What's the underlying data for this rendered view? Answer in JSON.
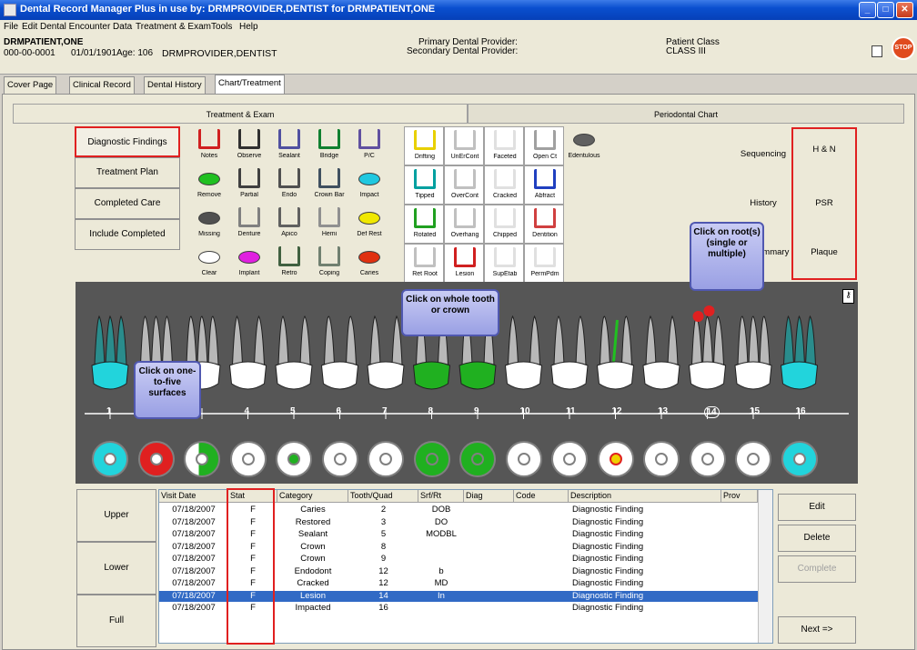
{
  "window": {
    "title": "Dental Record Manager Plus in use by: DRMPROVIDER,DENTIST for DRMPATIENT,ONE"
  },
  "menu": [
    "File",
    "Edit",
    "Dental Encounter Data",
    "Treatment & Exam",
    "Tools",
    "Help"
  ],
  "patient": {
    "name": "DRMPATIENT,ONE",
    "id_line": "000-00-0001",
    "dob": "01/01/1901",
    "age": "Age: 106",
    "provider": "DRMPROVIDER,DENTIST",
    "primary_label": "Primary Dental Provider:",
    "secondary_label": "Secondary Dental Provider:",
    "class_label": "Patient Class",
    "class_value": "CLASS III"
  },
  "tabs": [
    "Cover Page",
    "Clinical Record",
    "Dental History",
    "Chart/Treatment"
  ],
  "subtabs": [
    "Treatment & Exam",
    "Periodontal Chart"
  ],
  "left_buttons": [
    "Diagnostic Findings",
    "Treatment Plan",
    "Completed Care",
    "Include Completed"
  ],
  "tools": [
    [
      "Notes",
      "Observe",
      "Sealant",
      "Bridge",
      "P/C",
      "Drifting",
      "UnErCont",
      "Faceted",
      "Open Ct",
      "Edentulous"
    ],
    [
      "Remove",
      "Partial",
      "Endo",
      "Crown Bar",
      "Impact",
      "Tipped",
      "OverCont",
      "Cracked",
      "Abfract",
      ""
    ],
    [
      "Missing",
      "Denture",
      "Apico",
      "Hemi",
      "Def Rest",
      "Rotated",
      "Overhang",
      "Chipped",
      "Dentition",
      ""
    ],
    [
      "Clear",
      "Implant",
      "Retro",
      "Coping",
      "Caries",
      "Ret Root",
      "Lesion",
      "SupEtab",
      "PermPdm",
      ""
    ]
  ],
  "side_buttons": [
    "Sequencing",
    "History",
    "Summary"
  ],
  "red_buttons": [
    "H & N",
    "PSR",
    "Plaque"
  ],
  "callouts": {
    "whole": "Click on whole tooth or crown",
    "root": "Click on root(s) (single or multiple)",
    "surface": "Click on one-to-five surfaces"
  },
  "tooth_numbers": [
    "1",
    "4",
    "5",
    "6",
    "7",
    "8",
    "9",
    "10",
    "11",
    "12",
    "13",
    "14",
    "15",
    "16"
  ],
  "arch_tabs": [
    "Upper",
    "Lower",
    "Full"
  ],
  "grid": {
    "headers": [
      "Visit Date",
      "Stat",
      "Category",
      "Tooth/Quad",
      "Srf/Rt",
      "Diag",
      "Code",
      "Description",
      "Prov"
    ],
    "rows": [
      [
        "07/18/2007",
        "F",
        "Caries",
        "2",
        "DOB",
        "",
        "",
        "Diagnostic Finding",
        ""
      ],
      [
        "07/18/2007",
        "F",
        "Restored",
        "3",
        "DO",
        "",
        "",
        "Diagnostic Finding",
        ""
      ],
      [
        "07/18/2007",
        "F",
        "Sealant",
        "5",
        "MODBL",
        "",
        "",
        "Diagnostic Finding",
        ""
      ],
      [
        "07/18/2007",
        "F",
        "Crown",
        "8",
        "",
        "",
        "",
        "Diagnostic Finding",
        ""
      ],
      [
        "07/18/2007",
        "F",
        "Crown",
        "9",
        "",
        "",
        "",
        "Diagnostic Finding",
        ""
      ],
      [
        "07/18/2007",
        "F",
        "Endodont",
        "12",
        "b",
        "",
        "",
        "Diagnostic Finding",
        ""
      ],
      [
        "07/18/2007",
        "F",
        "Cracked",
        "12",
        "MD",
        "",
        "",
        "Diagnostic Finding",
        ""
      ],
      [
        "07/18/2007",
        "F",
        "Lesion",
        "14",
        "In",
        "",
        "",
        "Diagnostic Finding",
        ""
      ],
      [
        "07/18/2007",
        "F",
        "Impacted",
        "16",
        "",
        "",
        "",
        "Diagnostic Finding",
        ""
      ]
    ],
    "selected_row": 7
  },
  "right_buttons": [
    "Edit",
    "Delete",
    "Complete",
    "Next =>"
  ],
  "colors": {
    "title_bar": "#0a4fcf",
    "highlight_red": "#e02020",
    "crown_green": "#20b020",
    "tooth_cyan": "#22d4dc",
    "selection": "#316ac5"
  }
}
